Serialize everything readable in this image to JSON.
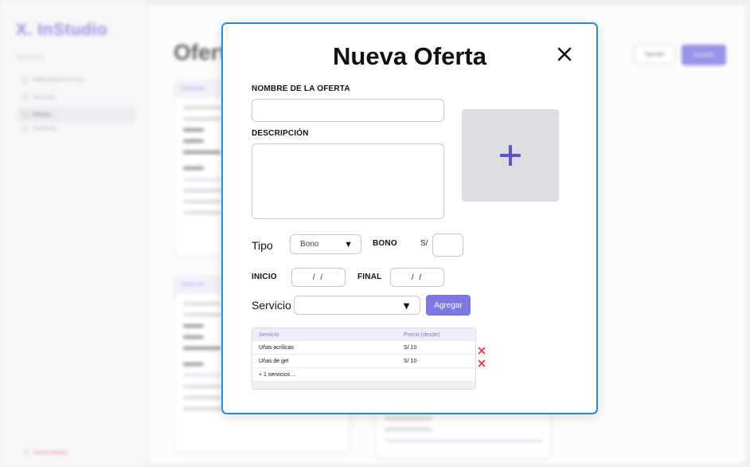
{
  "background": {
    "logo": "X. InStudio",
    "section_label": "GENERAL",
    "nav": [
      "Información General",
      "Servicios",
      "Ofertas",
      "Analíticas"
    ],
    "logout": "Cerrar Sesión",
    "page_title": "Ofertas",
    "btn_secondary": "Agregar",
    "btn_primary": "Guardar",
    "card_title": "Manicure"
  },
  "modal": {
    "title": "Nueva Oferta",
    "close_icon": "close-icon",
    "name_label": "NOMBRE DE LA OFERTA",
    "name_value": "",
    "description_label": "DESCRIPCIÓN",
    "description_value": "",
    "image_upload_icon": "plus-icon",
    "tipo_label": "Tipo",
    "tipo_value": "Bono",
    "bono_label": "BONO",
    "currency": "S/",
    "bono_value": "",
    "inicio_label": "INICIO",
    "inicio_value": "/ /",
    "final_label": "FINAL",
    "final_value": "/ /",
    "servicio_label": "Servicio",
    "servicio_value": "",
    "agregar_label": "Agregar",
    "table": {
      "headers": [
        "Servicio",
        "Precio (desde)"
      ],
      "rows": [
        {
          "servicio": "Uñas acrílicas",
          "precio": "S/ 10"
        },
        {
          "servicio": "Uñas de gel",
          "precio": "S/ 10"
        }
      ],
      "more": "+ 1 servicios ..."
    }
  },
  "colors": {
    "accent": "#7b78e4",
    "modal_border": "#2a8bd8",
    "delete": "#e0303a"
  }
}
